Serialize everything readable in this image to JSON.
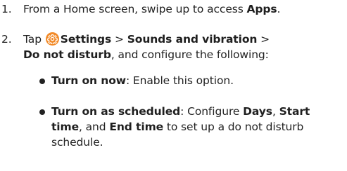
{
  "steps": [
    {
      "number": "1.",
      "pre": "From a Home screen, swipe up to access ",
      "bold": "Apps",
      "post": "."
    },
    {
      "number": "2.",
      "tap": "Tap ",
      "settings": "Settings",
      "sep1": " > ",
      "sounds": "Sounds and vibration",
      "sep2": " >",
      "dnd": "Do not disturb",
      "post": ", and configure the following:"
    }
  ],
  "bullets": [
    {
      "bold": "Turn on now",
      "text": ": Enable this option."
    },
    {
      "bold": "Turn on as scheduled",
      "text1": ": Configure ",
      "days": "Days",
      "text2": ", ",
      "start": "Start time",
      "text3": ", and ",
      "end": "End time",
      "text4": " to set up a do not disturb schedule."
    }
  ],
  "icons": {
    "settings": "gear-icon",
    "settings_color": "#f28a28"
  }
}
